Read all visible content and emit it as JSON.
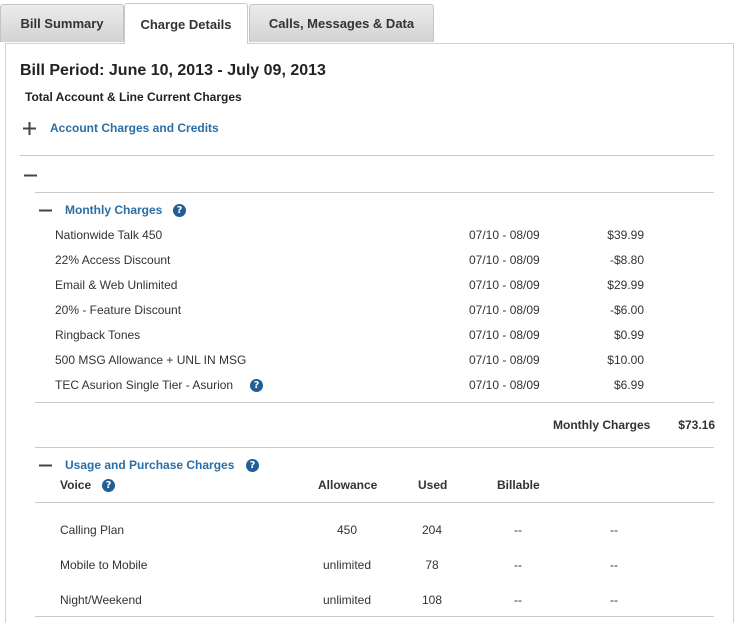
{
  "tabs": [
    {
      "label": "Bill Summary",
      "active": false
    },
    {
      "label": "Charge Details",
      "active": true
    },
    {
      "label": "Calls, Messages & Data",
      "active": false
    }
  ],
  "bill_period": "Bill Period: June 10, 2013 - July 09, 2013",
  "total_heading": "Total Account & Line Current Charges",
  "account_section": {
    "label": "Account Charges and Credits",
    "expanded": false
  },
  "monthly": {
    "label": "Monthly Charges",
    "items": [
      {
        "name": "Nationwide Talk 450",
        "period": "07/10 - 08/09",
        "amount": "$39.99"
      },
      {
        "name": "22% Access Discount",
        "period": "07/10 - 08/09",
        "amount": "-$8.80"
      },
      {
        "name": "Email & Web Unlimited",
        "period": "07/10 - 08/09",
        "amount": "$29.99"
      },
      {
        "name": "20% - Feature Discount",
        "period": "07/10 - 08/09",
        "amount": "-$6.00"
      },
      {
        "name": "Ringback Tones",
        "period": "07/10 - 08/09",
        "amount": "$0.99"
      },
      {
        "name": "500 MSG Allowance + UNL IN MSG",
        "period": "07/10 - 08/09",
        "amount": "$10.00"
      },
      {
        "name": "TEC Asurion Single Tier - Asurion",
        "period": "07/10 - 08/09",
        "amount": "$6.99",
        "has_help": true
      }
    ],
    "total_label": "Monthly Charges",
    "total_amount": "$73.16"
  },
  "usage": {
    "label": "Usage and Purchase Charges",
    "columns": {
      "voice": "Voice",
      "allowance": "Allowance",
      "used": "Used",
      "billable": "Billable"
    },
    "rows": [
      {
        "name": "Calling Plan",
        "allowance": "450",
        "used": "204",
        "billable": "--",
        "cost": "--"
      },
      {
        "name": "Mobile to Mobile",
        "allowance": "unlimited",
        "used": "78",
        "billable": "--",
        "cost": "--"
      },
      {
        "name": "Night/Weekend",
        "allowance": "unlimited",
        "used": "108",
        "billable": "--",
        "cost": "--"
      }
    ]
  },
  "icons": {
    "help": "question-circle-icon",
    "expand": "plus-icon",
    "collapse": "minus-icon"
  },
  "colors": {
    "link": "#2a6ea6",
    "help_icon": "#1f5f95"
  },
  "help_glyph": "?"
}
